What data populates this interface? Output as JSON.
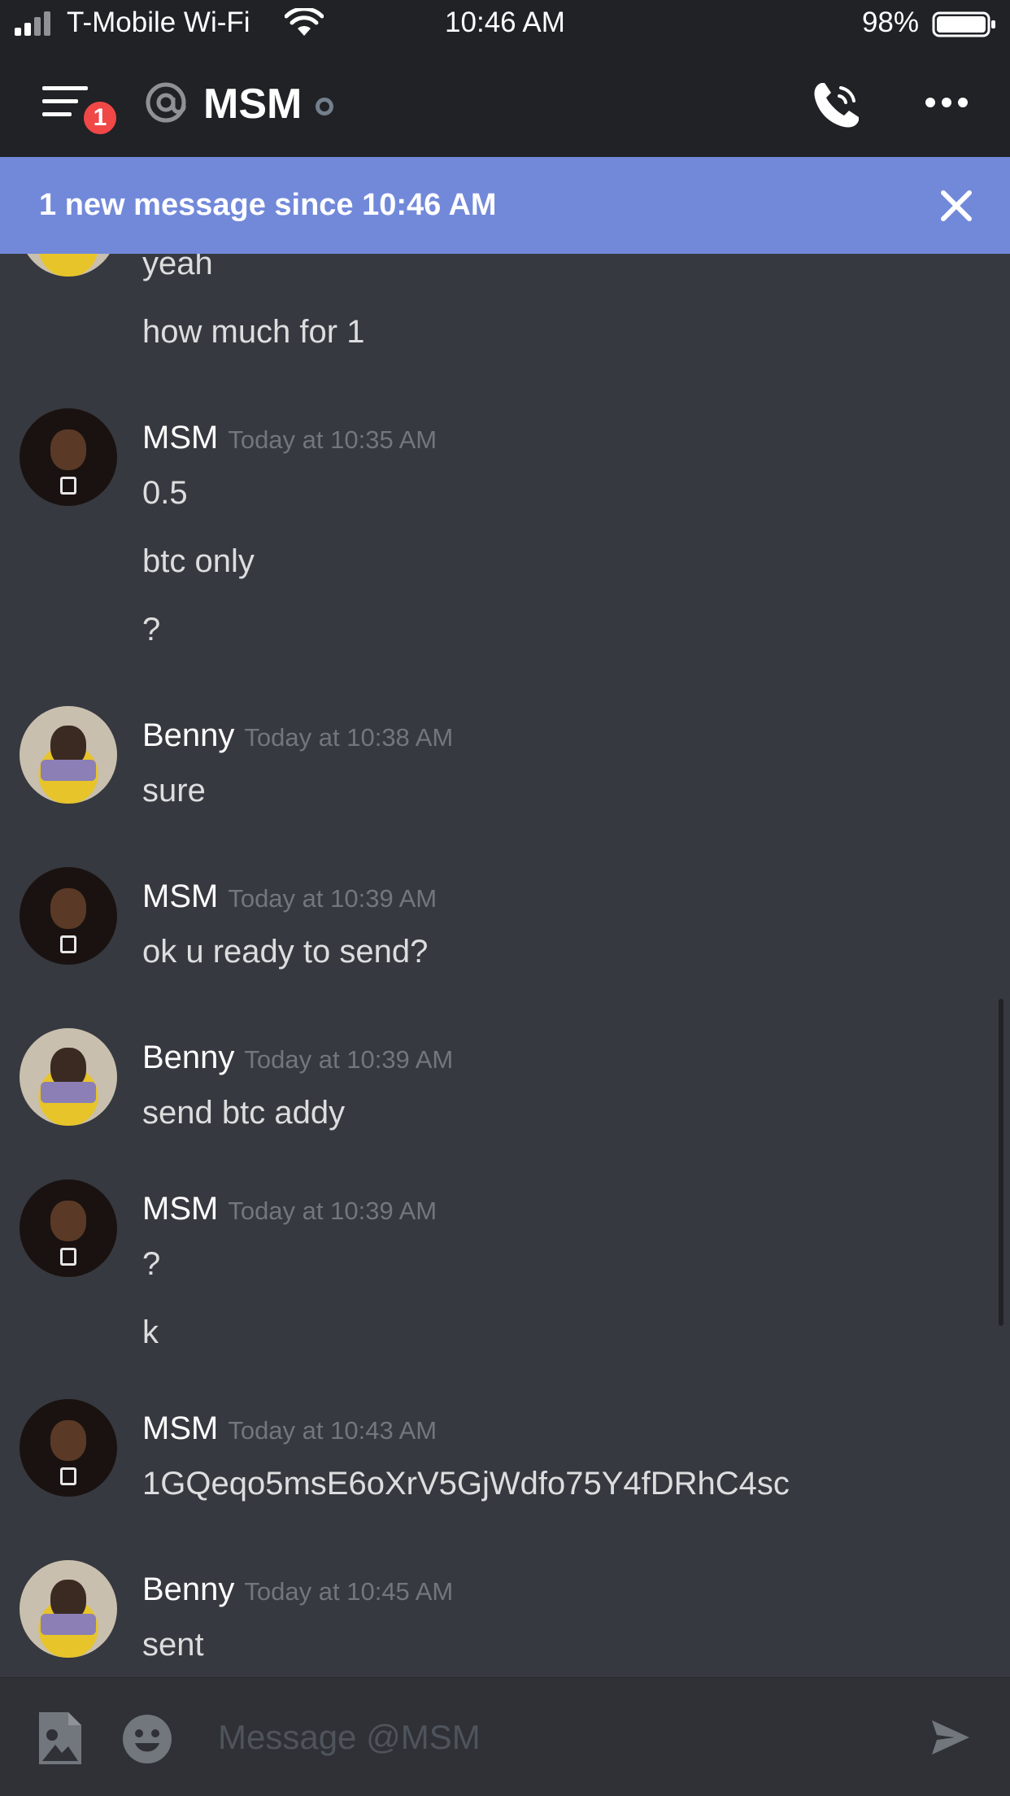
{
  "status_bar": {
    "carrier": "T-Mobile Wi-Fi",
    "time": "10:46 AM",
    "battery": "98%"
  },
  "header": {
    "unread_count": "1",
    "title": "MSM",
    "icons": [
      "menu-icon",
      "at-icon",
      "presence-icon",
      "call-icon",
      "more-icon"
    ]
  },
  "banner": {
    "text": "1 new message since 10:46 AM"
  },
  "messages": [
    {
      "type": "continuation",
      "text": "yeah"
    },
    {
      "type": "continuation",
      "text": "how much for 1"
    },
    {
      "type": "group",
      "author": "MSM",
      "timestamp": "Today at 10:35 AM",
      "lines": [
        "0.5",
        "btc only",
        "?"
      ]
    },
    {
      "type": "group",
      "author": "Benny",
      "timestamp": "Today at 10:38 AM",
      "lines": [
        "sure"
      ]
    },
    {
      "type": "group",
      "author": "MSM",
      "timestamp": "Today at 10:39 AM",
      "lines": [
        "ok u ready to send?"
      ]
    },
    {
      "type": "group",
      "author": "Benny",
      "timestamp": "Today at 10:39 AM",
      "lines": [
        "send btc addy"
      ]
    },
    {
      "type": "group",
      "author": "MSM",
      "timestamp": "Today at 10:39 AM",
      "lines": [
        "?",
        "k"
      ]
    },
    {
      "type": "group",
      "author": "MSM",
      "timestamp": "Today at 10:43 AM",
      "lines": [
        "1GQeqo5msE6oXrV5GjWdfo75Y4fDRhC4sc"
      ]
    },
    {
      "type": "group",
      "author": "Benny",
      "timestamp": "Today at 10:45 AM",
      "lines": [
        "sent"
      ]
    }
  ],
  "composer": {
    "placeholder": "Message @MSM",
    "value": ""
  },
  "colors": {
    "background": "#36393f",
    "header": "#202225",
    "banner": "#7289da",
    "badge": "#f04747"
  }
}
